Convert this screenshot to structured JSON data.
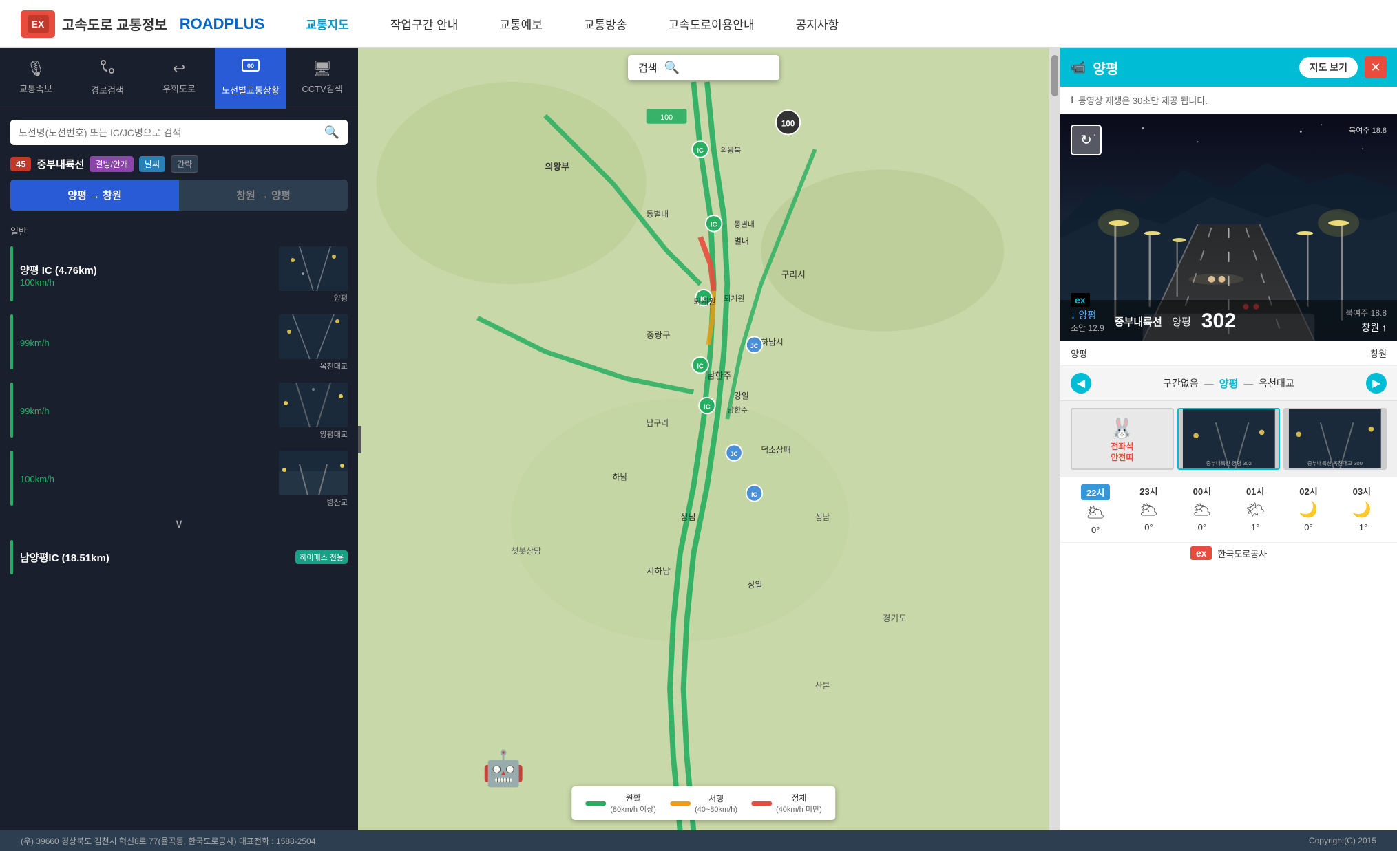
{
  "header": {
    "logo_ko": "고속도로 교통정보",
    "logo_en": "ROADPLUS",
    "nav_items": [
      {
        "label": "교통지도",
        "active": true
      },
      {
        "label": "작업구간 안내",
        "active": false
      },
      {
        "label": "교통예보",
        "active": false
      },
      {
        "label": "교통방송",
        "active": false
      },
      {
        "label": "고속도로이용안내",
        "active": false
      },
      {
        "label": "공지사항",
        "active": false
      }
    ]
  },
  "sidebar": {
    "tabs": [
      {
        "icon": "🎙",
        "label": "교통속보",
        "active": false
      },
      {
        "icon": "🔍",
        "label": "경로검색",
        "active": false
      },
      {
        "icon": "↩",
        "label": "우회도로",
        "active": false
      },
      {
        "icon": "🛣",
        "label": "노선별교통상황",
        "active": true
      },
      {
        "icon": "📷",
        "label": "CCTV검색",
        "active": false
      }
    ],
    "search_placeholder": "노선명(노선번호) 또는 IC/JC명으로 검색",
    "route_badge": "45",
    "route_name": "중부내륙선",
    "tags": [
      "결빙/안개",
      "날씨",
      "간략"
    ],
    "direction_buttons": [
      {
        "label": "양평 → 창원",
        "active": true
      },
      {
        "label": "창원 → 양평",
        "active": false
      }
    ],
    "section_label": "일반",
    "route_items": [
      {
        "ic_name": "양평 IC (4.76km)",
        "speed": "100km/h",
        "location_label": "양평"
      },
      {
        "ic_name": "",
        "speed": "99km/h",
        "location_label": "옥천대교"
      },
      {
        "ic_name": "",
        "speed": "99km/h",
        "location_label": "양평대교"
      },
      {
        "ic_name": "",
        "speed": "100km/h",
        "location_label": "병산교"
      },
      {
        "ic_name": "남양평IC (18.51km)",
        "speed": "",
        "location_label": "",
        "badge": "하이패스 전용"
      }
    ]
  },
  "map": {
    "search_label": "검색",
    "legend": [
      {
        "label": "원활\n(80km/h 이상)",
        "color": "#27ae60"
      },
      {
        "label": "서행\n(40~80km/h)",
        "color": "#f39c12"
      },
      {
        "label": "정체\n(40km/h 미만)",
        "color": "#e74c3c"
      }
    ]
  },
  "cctv": {
    "title": "양평",
    "map_btn_label": "지도 보기",
    "notice": "동영상 재생은 30초만 제공 됩니다.",
    "video_info": {
      "route": "중부내륙선",
      "location": "양평",
      "km": "302",
      "origin": "양평",
      "destination": "창원",
      "speed_left_label": "↓ 양평",
      "speed_left_val": "조안 12.9",
      "speed_right_label": "북여주 18.8",
      "speed_right_arrow": "창원 ↑"
    },
    "direction_bar": {
      "left": "양평",
      "right": "창원"
    },
    "nav": {
      "section": "구간없음",
      "from": "양평",
      "to": "옥천대교"
    },
    "thumbnails": [
      {
        "label": "전좌석\n안전띠",
        "type": "mascot"
      },
      {
        "label": "",
        "type": "road",
        "selected": true
      },
      {
        "label": "",
        "type": "road2",
        "selected": false
      }
    ],
    "weather": [
      {
        "time": "22시",
        "icon": "🌥",
        "temp": "0°",
        "active": true
      },
      {
        "time": "23시",
        "icon": "🌥",
        "temp": "0°",
        "active": false
      },
      {
        "time": "00시",
        "icon": "🌥",
        "temp": "0°",
        "active": false
      },
      {
        "time": "01시",
        "icon": "🌤",
        "temp": "1°",
        "active": false
      },
      {
        "time": "02시",
        "icon": "🌙",
        "temp": "0°",
        "active": false
      },
      {
        "time": "03시",
        "icon": "🌙",
        "temp": "-1°",
        "active": false
      }
    ],
    "ex_logo": "ex",
    "footer_text": "한국도로공사"
  },
  "footer": {
    "address": "(우) 39660 경상북도 김천시 혁신8로 77(율곡동, 한국도로공사) 대표전화 : 1588-2504",
    "copyright": "Copyright(C) 2015"
  }
}
